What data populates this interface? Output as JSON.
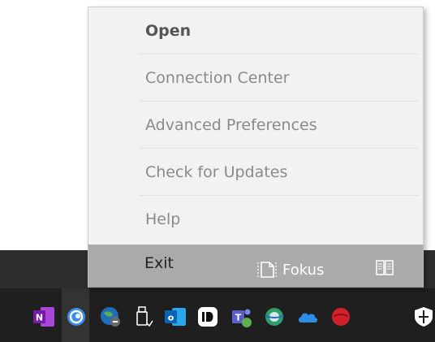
{
  "menu": {
    "items": [
      {
        "label": "Open",
        "bold": true
      },
      {
        "label": "Connection Center",
        "bold": false
      },
      {
        "label": "Advanced Preferences",
        "bold": false
      },
      {
        "label": "Check for Updates",
        "bold": false
      },
      {
        "label": "Help",
        "bold": false
      },
      {
        "label": "Exit",
        "bold": false
      }
    ]
  },
  "taskbar": {
    "fokus_label": "Fokus",
    "icons": [
      "onenote-icon",
      "citrix-icon",
      "network-globe-icon",
      "usb-drive-icon",
      "outlook-icon",
      "id-app-icon",
      "teams-icon",
      "browser-globe-icon",
      "onedrive-cloud-icon",
      "red-app-icon",
      "shield-icon"
    ]
  },
  "colors": {
    "menu_bg": "#f2f2f2",
    "taskbar_bg": "#1f1f1f",
    "onenote": "#7719aa",
    "outlook": "#0a64b4",
    "teams": "#5b5fc7",
    "onedrive": "#2d8ee6",
    "red_app": "#d0202a"
  }
}
